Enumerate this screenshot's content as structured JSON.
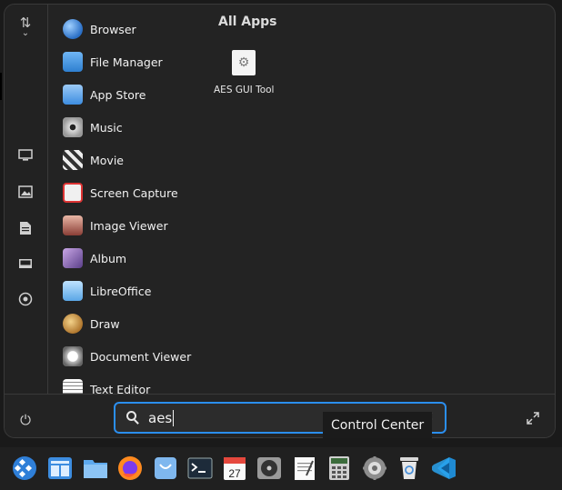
{
  "launcher": {
    "section_title": "All Apps",
    "apps": [
      {
        "label": "Browser",
        "icon": "browser-icon"
      },
      {
        "label": "File Manager",
        "icon": "file-manager-icon"
      },
      {
        "label": "App Store",
        "icon": "app-store-icon"
      },
      {
        "label": "Music",
        "icon": "music-icon"
      },
      {
        "label": "Movie",
        "icon": "movie-icon"
      },
      {
        "label": "Screen Capture",
        "icon": "screen-capture-icon"
      },
      {
        "label": "Image Viewer",
        "icon": "image-viewer-icon"
      },
      {
        "label": "Album",
        "icon": "album-icon"
      },
      {
        "label": "LibreOffice",
        "icon": "libreoffice-icon"
      },
      {
        "label": "Draw",
        "icon": "draw-icon"
      },
      {
        "label": "Document Viewer",
        "icon": "document-viewer-icon"
      },
      {
        "label": "Text Editor",
        "icon": "text-editor-icon"
      }
    ],
    "results": [
      {
        "label": "AES GUI Tool",
        "icon": "aes-gui-tool-icon"
      }
    ],
    "search": {
      "value": "aes"
    },
    "rail_icons": [
      "sort-icon",
      "computer-icon",
      "pictures-icon",
      "documents-icon",
      "desktop-icon",
      "music-folder-icon"
    ]
  },
  "tooltip": "Control Center",
  "taskbar": {
    "icons": [
      "launcher-icon",
      "multitasking-icon",
      "file-manager-icon",
      "firefox-icon",
      "app-store-icon",
      "terminal-icon",
      "calendar-icon",
      "music-icon",
      "text-editor-icon",
      "calculator-icon",
      "control-center-icon",
      "trash-icon",
      "vscode-icon"
    ],
    "calendar_day": "27"
  },
  "colors": {
    "accent": "#2b8ff0",
    "panel": "#232323",
    "taskbar": "#202020"
  }
}
